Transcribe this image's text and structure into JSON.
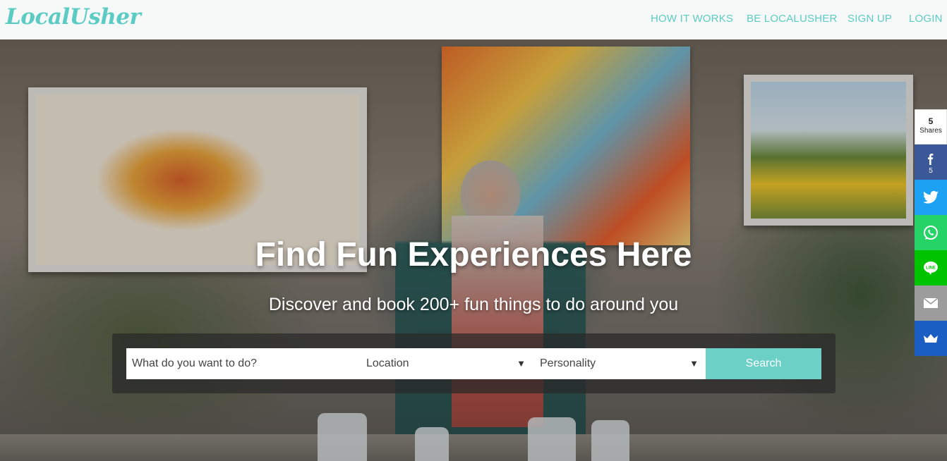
{
  "header": {
    "logo": "LocalUsher",
    "nav": [
      {
        "label": "HOW IT WORKS"
      },
      {
        "label": "BE LOCALUSHER"
      },
      {
        "label": "SIGN UP"
      },
      {
        "label": "LOGIN"
      }
    ]
  },
  "hero": {
    "headline": "Find Fun Experiences Here",
    "subhead": "Discover and book 200+ fun things to do around you"
  },
  "search": {
    "query_placeholder": "What do you want to do?",
    "location_value": "Location",
    "personality_value": "Personality",
    "button_label": "Search"
  },
  "share": {
    "count": "5",
    "count_label": "Shares",
    "facebook_count": "5",
    "buttons": [
      {
        "icon": "facebook-icon",
        "color": "#3b5998"
      },
      {
        "icon": "twitter-icon",
        "color": "#1da1f2"
      },
      {
        "icon": "whatsapp-icon",
        "color": "#25d366"
      },
      {
        "icon": "line-icon",
        "color": "#00c300"
      },
      {
        "icon": "email-icon",
        "color": "#9c9c9c"
      },
      {
        "icon": "sumo-crown-icon",
        "color": "#1a5ec4"
      }
    ]
  },
  "colors": {
    "brand": "#5ccbc4",
    "search_button": "#6dd0c7"
  }
}
